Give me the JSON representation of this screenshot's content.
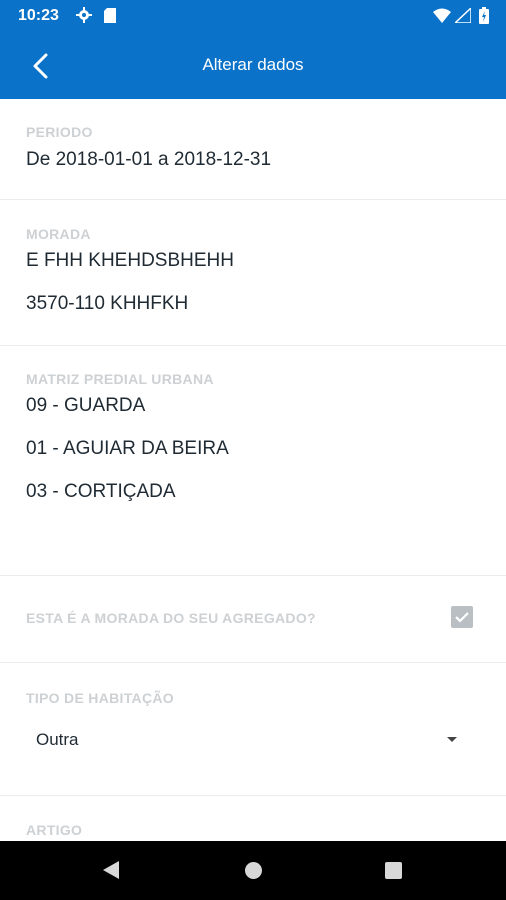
{
  "status_bar": {
    "time": "10:23",
    "icons": [
      "gear-icon",
      "sd-card-icon",
      "wifi-icon",
      "signal-icon",
      "battery-icon"
    ]
  },
  "app_bar": {
    "title": "Alterar dados",
    "back_icon": "chevron-left-icon"
  },
  "periodo": {
    "label": "PERIODO",
    "value": "De 2018-01-01 a 2018-12-31"
  },
  "morada": {
    "label": "MORADA",
    "line1": "E FHH KHEHDSBHEHH",
    "line2": "3570-110 KHHFKH"
  },
  "matriz": {
    "label": "MATRIZ PREDIAL URBANA",
    "distrito": "09 - GUARDA",
    "concelho": "01 - AGUIAR DA BEIRA",
    "freguesia": "03 - CORTIÇADA"
  },
  "agregado": {
    "label": "ESTA É A MORADA DO SEU AGREGADO?",
    "checked": true
  },
  "habitacao": {
    "label": "TIPO DE HABITAÇÃO",
    "selected": "Outra"
  },
  "artigo": {
    "label": "ARTIGO"
  },
  "colors": {
    "primary": "#0a72c8",
    "label_gray": "#cdd1d4",
    "text": "#1f2a33"
  }
}
